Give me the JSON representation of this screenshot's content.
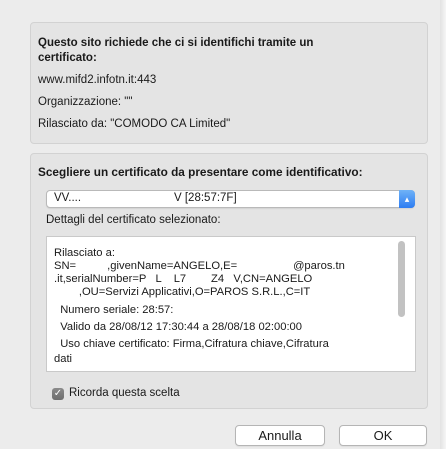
{
  "info": {
    "heading_line1": "Questo sito richiede che ci si identifichi tramite un",
    "heading_line2": "certificato:",
    "host": "www.mifd2.infotn.it:443",
    "organization": "Organizzazione: \"\"",
    "issued_by": "Rilasciato da: \"COMODO CA Limited\""
  },
  "selection": {
    "heading": "Scegliere un certificato da presentare come identificativo:",
    "popup_value_left": "VV....",
    "popup_value_right": "V [28:57:7F]",
    "details_label": "Dettagli del certificato selezionato:",
    "details_lines": [
      "Rilasciato a:",
      "SN=          ,givenName=ANGELO,E=                  @paros.tn",
      ".it,serialNumber=P   L    L7        Z4   V,CN=ANGELO",
      "        ,OU=Servizi Applicativi,O=PAROS S.R.L.,C=IT",
      "  Numero seriale: 28:57:",
      "  Valido da 28/08/12 17:30:44 a 28/08/18 02:00:00",
      "  Uso chiave certificato: Firma,Cifratura chiave,Cifratura",
      "dati"
    ],
    "remember_label": "Ricorda questa scelta",
    "remember_checked": true
  },
  "buttons": {
    "cancel": "Annulla",
    "ok": "OK"
  }
}
